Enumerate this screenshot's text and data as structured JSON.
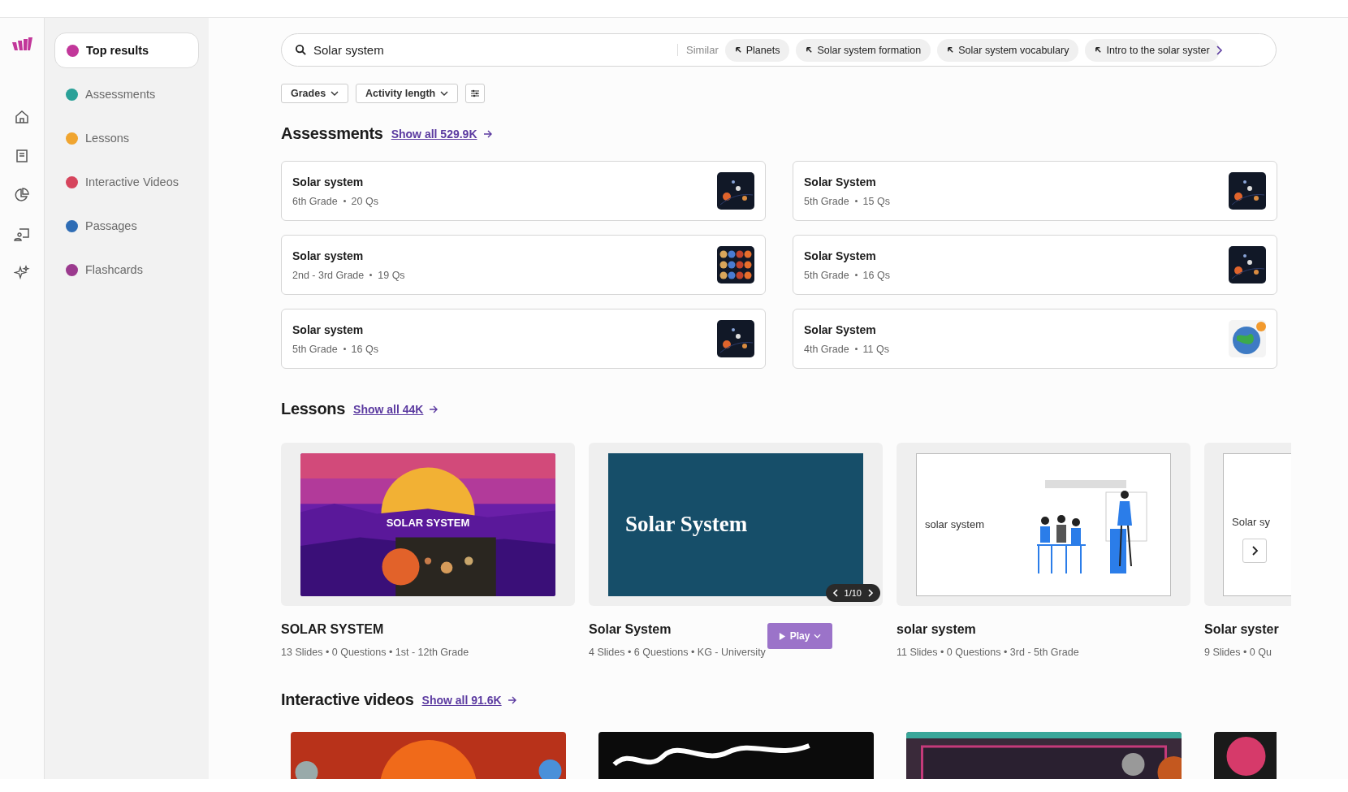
{
  "sidebar": {
    "items": [
      {
        "label": "Top results",
        "selected": true,
        "color": "#c2379a"
      },
      {
        "label": "Assessments",
        "selected": false,
        "color": "#2aa198"
      },
      {
        "label": "Lessons",
        "selected": false,
        "color": "#f0a530"
      },
      {
        "label": "Interactive Videos",
        "selected": false,
        "color": "#d6455d"
      },
      {
        "label": "Passages",
        "selected": false,
        "color": "#2f6db5"
      },
      {
        "label": "Flashcards",
        "selected": false,
        "color": "#9b3a8e"
      }
    ]
  },
  "search": {
    "value": "Solar system",
    "similar_label": "Similar",
    "chips": [
      "Planets",
      "Solar system formation",
      "Solar system vocabulary",
      "Intro to the solar syster"
    ]
  },
  "filters": [
    "Grades",
    "Activity length"
  ],
  "assessments": {
    "title": "Assessments",
    "show_all": "Show all 529.9K",
    "cards": [
      {
        "title": "Solar system",
        "grade": "6th Grade",
        "questions": "20 Qs"
      },
      {
        "title": "Solar System",
        "grade": "5th Grade",
        "questions": "15 Qs"
      },
      {
        "title": "Solar system",
        "grade": "2nd - 3rd Grade",
        "questions": "19 Qs"
      },
      {
        "title": "Solar System",
        "grade": "5th Grade",
        "questions": "16 Qs"
      },
      {
        "title": "Solar system",
        "grade": "5th Grade",
        "questions": "16 Qs"
      },
      {
        "title": "Solar System",
        "grade": "4th Grade",
        "questions": "11 Qs"
      }
    ]
  },
  "lessons": {
    "title": "Lessons",
    "show_all": "Show all 44K",
    "cards": [
      {
        "kind": "sunset",
        "slide_text": "SOLAR SYSTEM",
        "title": "SOLAR SYSTEM",
        "meta": "13 Slides • 0 Questions • 1st - 12th Grade"
      },
      {
        "kind": "plain",
        "slide_text": "Solar System",
        "title": "Solar System",
        "meta": "4 Slides • 6 Questions • KG - University",
        "pager": "1/10",
        "play": "Play"
      },
      {
        "kind": "illustration",
        "slide_text": "solar system",
        "title": "solar system",
        "meta": "11 Slides • 0 Questions • 3rd - 5th Grade"
      },
      {
        "kind": "cut",
        "slide_text": "Solar sy",
        "title": "Solar syster",
        "meta": "9 Slides • 0 Qu"
      }
    ]
  },
  "videos": {
    "title": "Interactive videos",
    "show_all": "Show all 91.6K"
  }
}
